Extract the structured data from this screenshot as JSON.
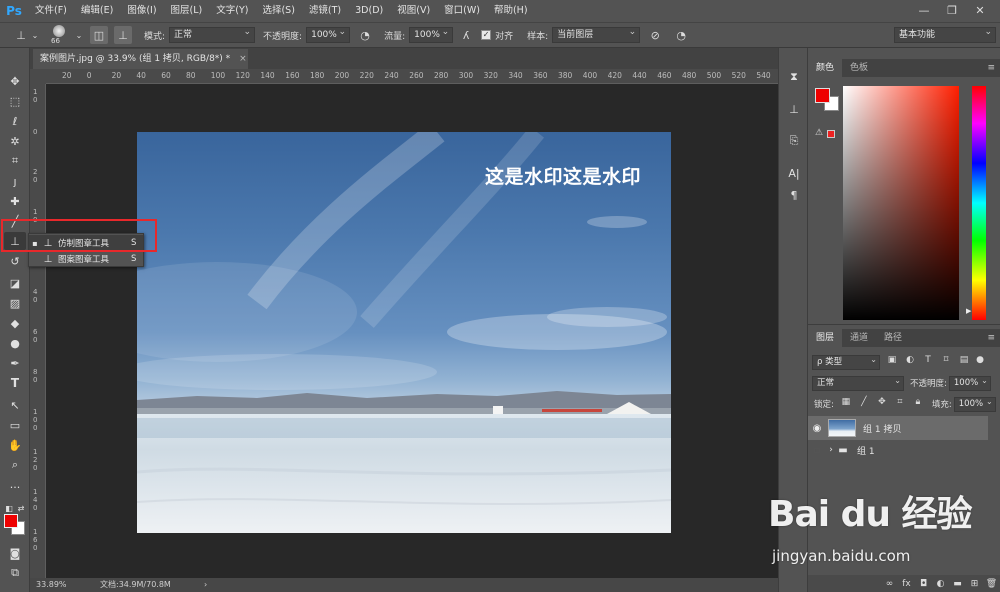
{
  "app": {
    "logo": "Ps"
  },
  "menu": [
    "文件(F)",
    "编辑(E)",
    "图像(I)",
    "图层(L)",
    "文字(Y)",
    "选择(S)",
    "滤镜(T)",
    "3D(D)",
    "视图(V)",
    "窗口(W)",
    "帮助(H)"
  ],
  "window_controls": {
    "minimize": "—",
    "restore": "❐",
    "close": "✕"
  },
  "options": {
    "brush_size": "66",
    "mode_label": "模式:",
    "mode_value": "正常",
    "opacity_label": "不透明度:",
    "opacity_value": "100%",
    "flow_label": "流量:",
    "flow_value": "100%",
    "align_label": "对齐",
    "sample_label": "样本:",
    "sample_value": "当前图层",
    "workspace": "基本功能"
  },
  "document": {
    "tab_title": "案例图片.jpg @ 33.9% (组 1 拷贝, RGB/8*) *",
    "close": "×",
    "watermark_text": "这是水印这是水印",
    "zoom": "33.89%",
    "doc_size": "文档:34.9M/70.8M"
  },
  "rulers": {
    "h": [
      "20",
      "0",
      "20",
      "40",
      "60",
      "80",
      "100",
      "120",
      "140",
      "160",
      "180",
      "200",
      "220",
      "240",
      "260",
      "280",
      "300",
      "320",
      "340",
      "360",
      "380",
      "400",
      "420",
      "440",
      "460",
      "480",
      "500",
      "520",
      "540"
    ],
    "v": [
      "1 0",
      "0",
      "2 0",
      "1 0",
      "2 0",
      "4 0",
      "6 0",
      "8 0",
      "1 0 0",
      "1 2 0",
      "1 4 0",
      "1 6 0"
    ]
  },
  "flyout": {
    "items": [
      {
        "bullet": "▪",
        "label": "仿制图章工具",
        "key": "S"
      },
      {
        "bullet": "",
        "label": "图案图章工具",
        "key": "S"
      }
    ]
  },
  "color_panel": {
    "tabs": [
      "颜色",
      "色板"
    ],
    "fg": "#ee0000",
    "bg": "#ffffff"
  },
  "layers_panel": {
    "tabs": [
      "图层",
      "通道",
      "路径"
    ],
    "filter_label": "ρ 类型",
    "blend_mode": "正常",
    "opacity_label": "不透明度:",
    "opacity_value": "100%",
    "lock_label": "锁定:",
    "fill_label": "填充:",
    "fill_value": "100%",
    "layers": [
      {
        "name": "组 1 拷贝",
        "visible": true,
        "selected": true
      },
      {
        "name": "组 1",
        "visible": false,
        "selected": false
      }
    ],
    "footer_icons": [
      "link-icon",
      "fx-icon",
      "mask-icon",
      "adjustment-icon",
      "group-icon",
      "new-layer-icon",
      "trash-icon"
    ]
  },
  "overlay": {
    "brand": "Bai du 经验",
    "url": "jingyan.baidu.com"
  }
}
